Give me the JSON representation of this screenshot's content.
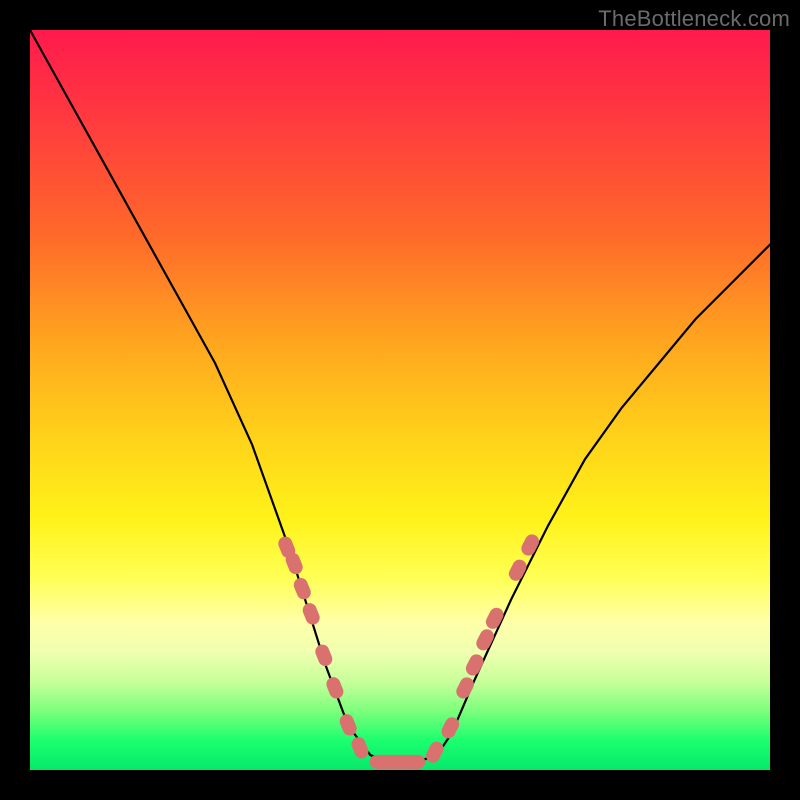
{
  "attribution": "TheBottleneck.com",
  "colors": {
    "gradient_top": "#ff1a4d",
    "gradient_mid": "#ffe81a",
    "gradient_bottom": "#06e86b",
    "pill": "#d9726e",
    "curve": "#000000",
    "frame": "#000000"
  },
  "chart_data": {
    "type": "line",
    "title": "",
    "xlabel": "",
    "ylabel": "",
    "xlim": [
      0,
      100
    ],
    "ylim": [
      0,
      100
    ],
    "grid": false,
    "legend": false,
    "annotations": [
      "TheBottleneck.com"
    ],
    "note": "x/y in percent of plot area; y measured from bottom. Curve is a V-shaped bottleneck profile with flat minimum.",
    "series": [
      {
        "name": "bottleneck-curve",
        "x": [
          0,
          5,
          10,
          15,
          20,
          25,
          30,
          35,
          37.5,
          40,
          43,
          46,
          49,
          52,
          55,
          57,
          60,
          65,
          70,
          75,
          80,
          85,
          90,
          95,
          100
        ],
        "y": [
          100,
          91,
          82,
          73,
          64,
          55,
          44,
          30,
          22,
          14,
          6,
          2,
          1,
          1,
          2,
          5,
          12,
          23,
          33,
          42,
          49,
          55,
          61,
          66,
          71
        ]
      }
    ],
    "markers": {
      "name": "highlight-pills",
      "color": "#d9726e",
      "groups": [
        {
          "side": "left-descent",
          "points": [
            {
              "x": 34.7,
              "y": 30.1
            },
            {
              "x": 35.7,
              "y": 27.9
            },
            {
              "x": 36.8,
              "y": 24.5
            },
            {
              "x": 38.0,
              "y": 21.1
            },
            {
              "x": 39.7,
              "y": 15.5
            },
            {
              "x": 41.2,
              "y": 11.1
            },
            {
              "x": 43.0,
              "y": 6.1
            },
            {
              "x": 44.6,
              "y": 3.0
            }
          ]
        },
        {
          "side": "flat-bottom",
          "shape": "bar",
          "x_range": [
            45.9,
            53.4
          ],
          "y": 1.1
        },
        {
          "side": "right-ascent",
          "points": [
            {
              "x": 54.7,
              "y": 2.4
            },
            {
              "x": 56.8,
              "y": 5.7
            },
            {
              "x": 58.8,
              "y": 11.1
            },
            {
              "x": 60.1,
              "y": 14.2
            },
            {
              "x": 61.5,
              "y": 17.6
            },
            {
              "x": 62.8,
              "y": 20.5
            },
            {
              "x": 65.9,
              "y": 27.0
            },
            {
              "x": 67.6,
              "y": 30.4
            }
          ]
        }
      ]
    }
  }
}
